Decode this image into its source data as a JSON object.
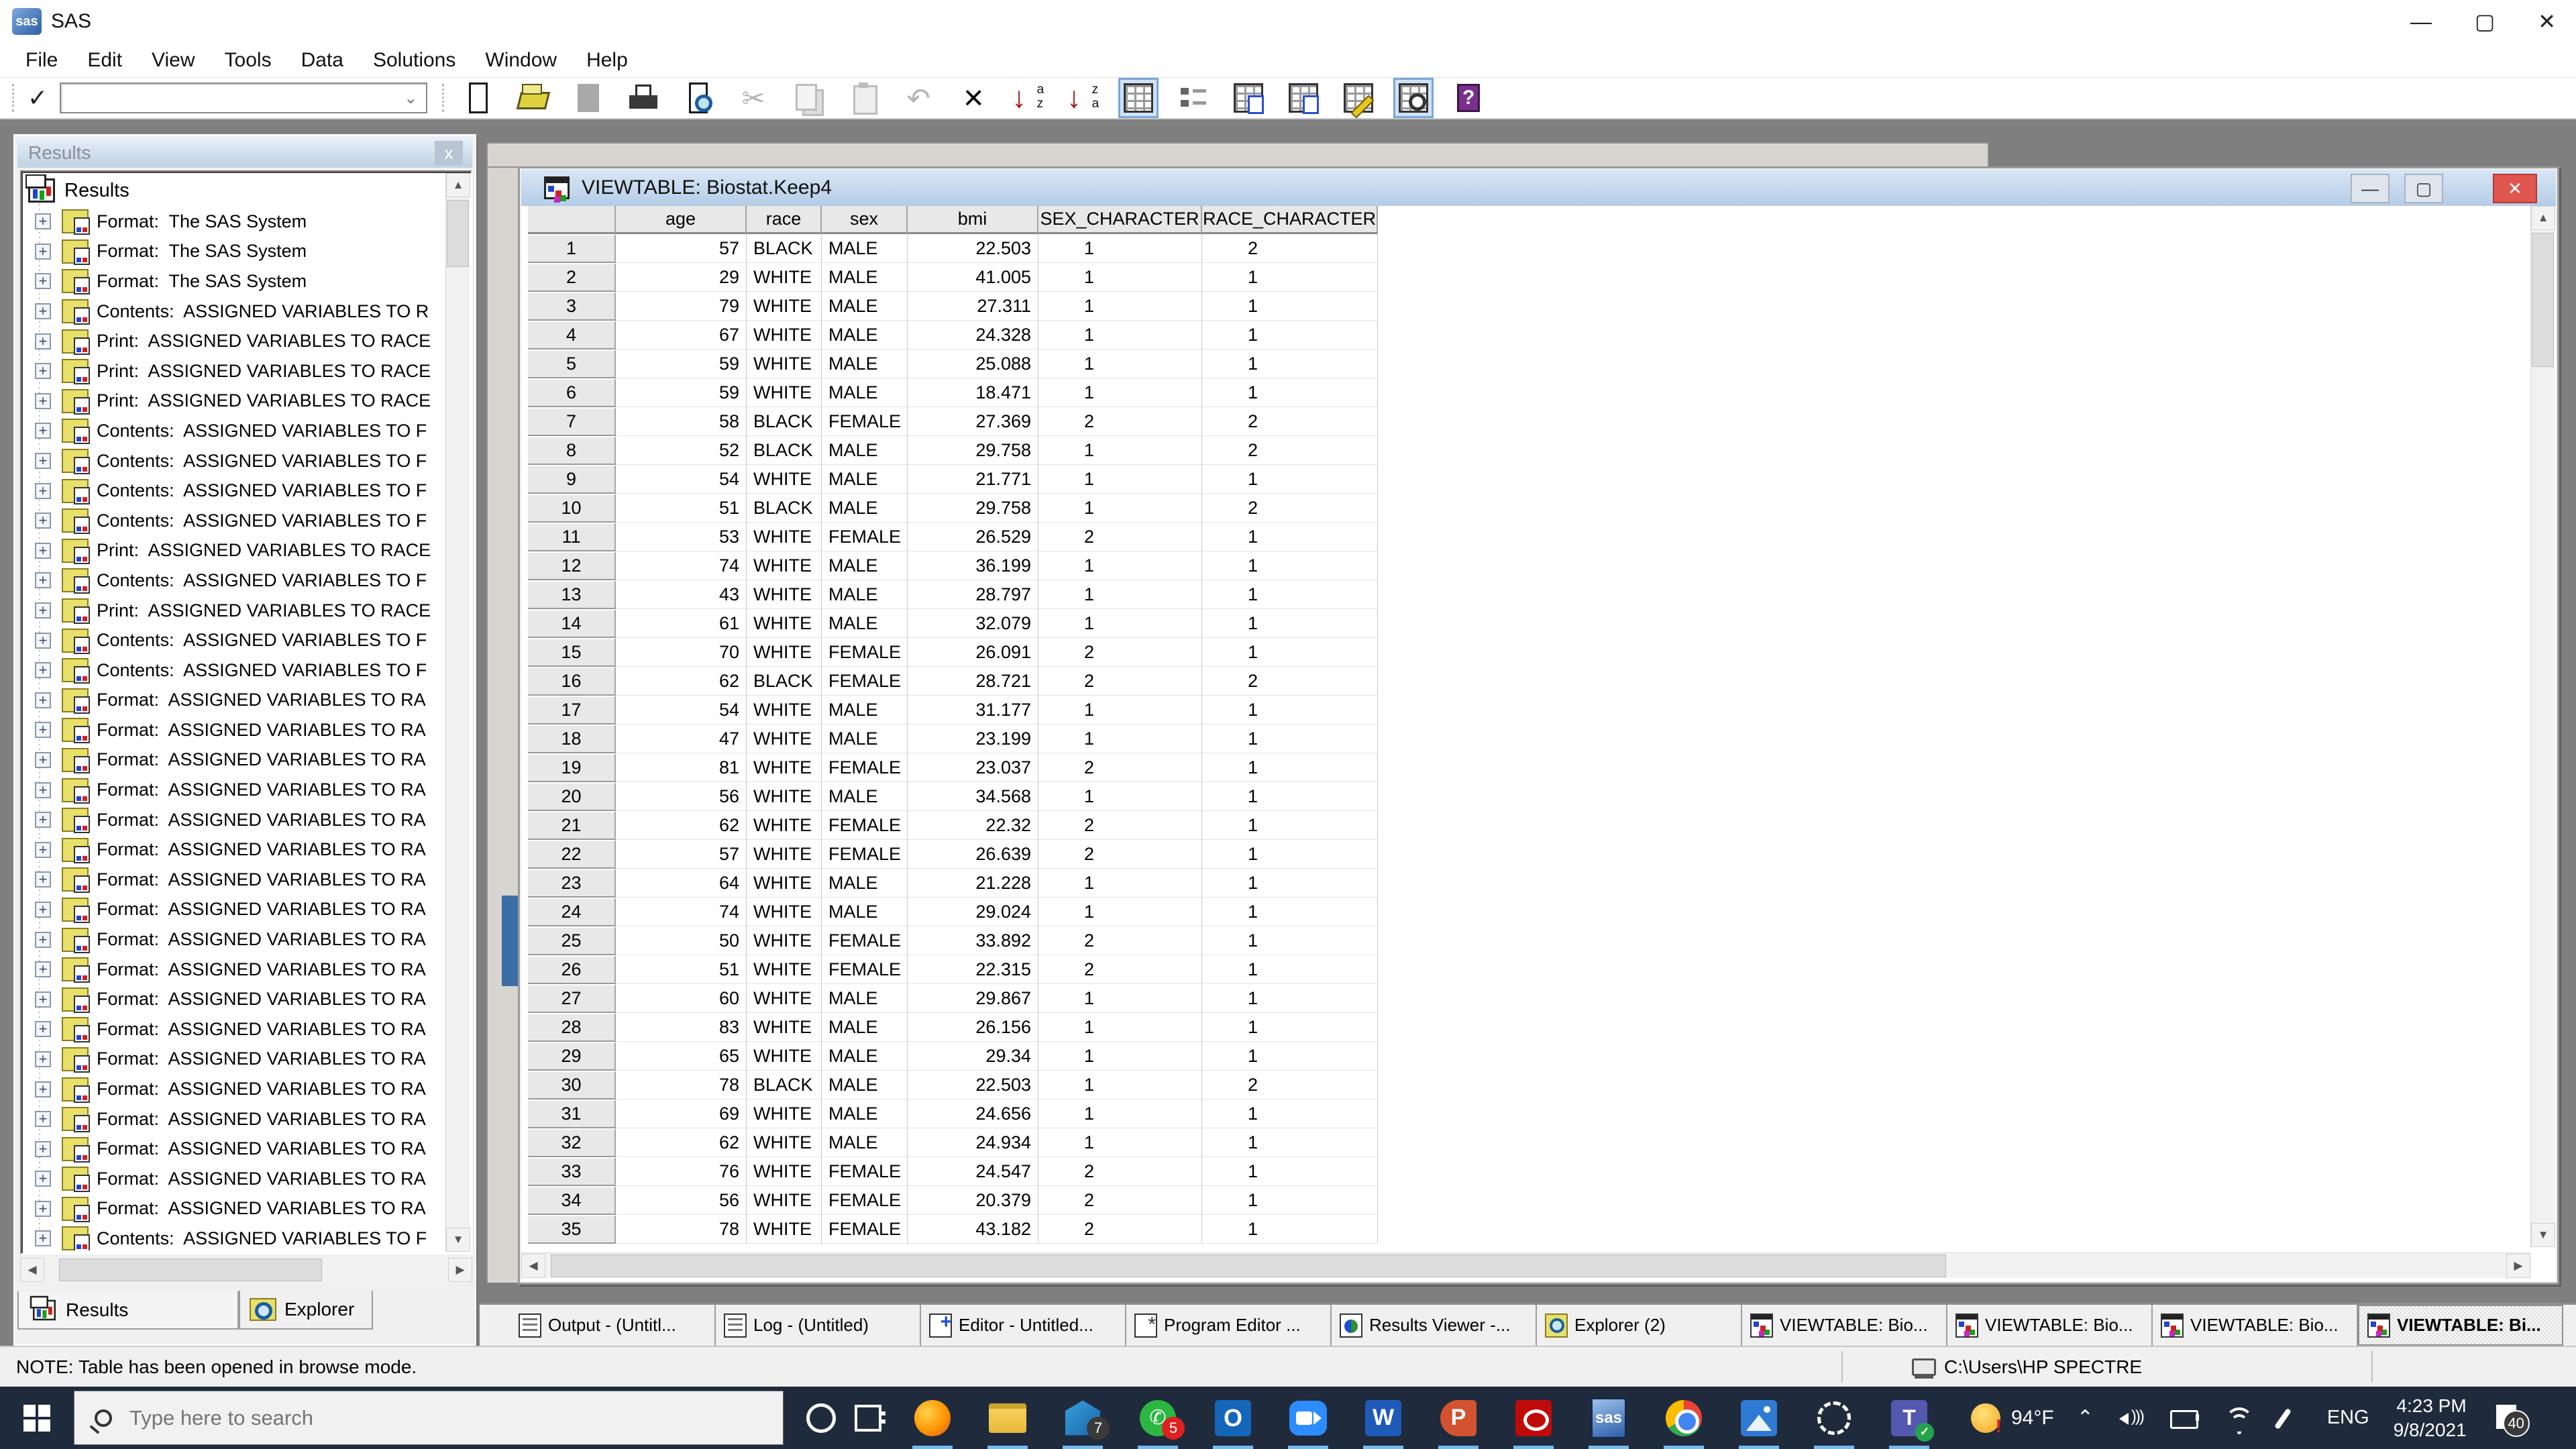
{
  "app": {
    "title": "SAS",
    "menu": [
      {
        "label": "File",
        "name": "menu-file"
      },
      {
        "label": "Edit",
        "name": "menu-edit"
      },
      {
        "label": "View",
        "name": "menu-view"
      },
      {
        "label": "Tools",
        "name": "menu-tools"
      },
      {
        "label": "Data",
        "name": "menu-data"
      },
      {
        "label": "Solutions",
        "name": "menu-solutions"
      },
      {
        "label": "Window",
        "name": "menu-window"
      },
      {
        "label": "Help",
        "name": "menu-help"
      }
    ],
    "window_controls": {
      "minimize": "—",
      "maximize": "▢",
      "close": "✕"
    }
  },
  "toolbar": {
    "command_value": "",
    "icons": [
      {
        "name": "new-document-icon",
        "cls": "tb-new"
      },
      {
        "name": "open-icon",
        "cls": "tb-open"
      },
      {
        "name": "save-icon",
        "cls": "tb-save"
      },
      {
        "name": "print-icon",
        "cls": "tb-print"
      },
      {
        "name": "print-preview-icon",
        "cls": "tb-preview"
      },
      {
        "name": "cut-icon",
        "cls": "tb-cut tb-gray"
      },
      {
        "name": "copy-icon",
        "cls": "tb-copy"
      },
      {
        "name": "paste-icon",
        "cls": "tb-paste"
      },
      {
        "name": "undo-icon",
        "cls": "tb-undo tb-gray"
      },
      {
        "name": "delete-icon",
        "cls": "tb-del"
      },
      {
        "name": "sort-ascending-icon",
        "cls": "tb-sortaz"
      },
      {
        "name": "sort-descending-icon",
        "cls": "tb-sortza"
      },
      {
        "name": "table-view-icon",
        "cls": "tb-grid on"
      },
      {
        "name": "form-view-icon",
        "cls": "tb-details"
      },
      {
        "name": "copy-rows-icon",
        "cls": "tb-grid tb-tdoc"
      },
      {
        "name": "paste-rows-icon",
        "cls": "tb-grid tb-tdoc2"
      },
      {
        "name": "edit-mode-icon",
        "cls": "tb-grid tb-tpencil"
      },
      {
        "name": "where-icon",
        "cls": "tb-grid tb-twhere on"
      },
      {
        "name": "help-book-icon",
        "cls": "tb-book"
      }
    ]
  },
  "results_panel": {
    "title": "Results",
    "root": "Results",
    "items": [
      {
        "label": "Format:  The SAS System"
      },
      {
        "label": "Format:  The SAS System"
      },
      {
        "label": "Format:  The SAS System"
      },
      {
        "label": "Contents:  ASSIGNED VARIABLES TO R"
      },
      {
        "label": "Print:  ASSIGNED VARIABLES TO RACE"
      },
      {
        "label": "Print:  ASSIGNED VARIABLES TO RACE"
      },
      {
        "label": "Print:  ASSIGNED VARIABLES TO RACE"
      },
      {
        "label": "Contents:  ASSIGNED VARIABLES TO F"
      },
      {
        "label": "Contents:  ASSIGNED VARIABLES TO F"
      },
      {
        "label": "Contents:  ASSIGNED VARIABLES TO F"
      },
      {
        "label": "Contents:  ASSIGNED VARIABLES TO F"
      },
      {
        "label": "Print:  ASSIGNED VARIABLES TO RACE"
      },
      {
        "label": "Contents:  ASSIGNED VARIABLES TO F"
      },
      {
        "label": "Print:  ASSIGNED VARIABLES TO RACE"
      },
      {
        "label": "Contents:  ASSIGNED VARIABLES TO F"
      },
      {
        "label": "Contents:  ASSIGNED VARIABLES TO F"
      },
      {
        "label": "Format:  ASSIGNED VARIABLES TO RA"
      },
      {
        "label": "Format:  ASSIGNED VARIABLES TO RA"
      },
      {
        "label": "Format:  ASSIGNED VARIABLES TO RA"
      },
      {
        "label": "Format:  ASSIGNED VARIABLES TO RA"
      },
      {
        "label": "Format:  ASSIGNED VARIABLES TO RA"
      },
      {
        "label": "Format:  ASSIGNED VARIABLES TO RA"
      },
      {
        "label": "Format:  ASSIGNED VARIABLES TO RA"
      },
      {
        "label": "Format:  ASSIGNED VARIABLES TO RA"
      },
      {
        "label": "Format:  ASSIGNED VARIABLES TO RA"
      },
      {
        "label": "Format:  ASSIGNED VARIABLES TO RA"
      },
      {
        "label": "Format:  ASSIGNED VARIABLES TO RA"
      },
      {
        "label": "Format:  ASSIGNED VARIABLES TO RA"
      },
      {
        "label": "Format:  ASSIGNED VARIABLES TO RA"
      },
      {
        "label": "Format:  ASSIGNED VARIABLES TO RA"
      },
      {
        "label": "Format:  ASSIGNED VARIABLES TO RA"
      },
      {
        "label": "Format:  ASSIGNED VARIABLES TO RA"
      },
      {
        "label": "Format:  ASSIGNED VARIABLES TO RA"
      },
      {
        "label": "Format:  ASSIGNED VARIABLES TO RA"
      },
      {
        "label": "Contents:  ASSIGNED VARIABLES TO F"
      }
    ],
    "tabs": {
      "results": "Results",
      "explorer": "Explorer"
    }
  },
  "viewtable": {
    "title": "VIEWTABLE: Biostat.Keep4",
    "columns": [
      {
        "label": "age",
        "cls": "c-age"
      },
      {
        "label": "race",
        "cls": "c-race"
      },
      {
        "label": "sex",
        "cls": "c-sex"
      },
      {
        "label": "bmi",
        "cls": "c-bmi"
      },
      {
        "label": "SEX_CHARACTER",
        "cls": "c-sx"
      },
      {
        "label": "RACE_CHARACTER",
        "cls": "c-rc"
      }
    ],
    "rows": [
      {
        "n": "1",
        "age": "57",
        "race": "BLACK",
        "sex": "MALE",
        "bmi": "22.503",
        "sx": "1",
        "rc": "2"
      },
      {
        "n": "2",
        "age": "29",
        "race": "WHITE",
        "sex": "MALE",
        "bmi": "41.005",
        "sx": "1",
        "rc": "1"
      },
      {
        "n": "3",
        "age": "79",
        "race": "WHITE",
        "sex": "MALE",
        "bmi": "27.311",
        "sx": "1",
        "rc": "1"
      },
      {
        "n": "4",
        "age": "67",
        "race": "WHITE",
        "sex": "MALE",
        "bmi": "24.328",
        "sx": "1",
        "rc": "1"
      },
      {
        "n": "5",
        "age": "59",
        "race": "WHITE",
        "sex": "MALE",
        "bmi": "25.088",
        "sx": "1",
        "rc": "1"
      },
      {
        "n": "6",
        "age": "59",
        "race": "WHITE",
        "sex": "MALE",
        "bmi": "18.471",
        "sx": "1",
        "rc": "1"
      },
      {
        "n": "7",
        "age": "58",
        "race": "BLACK",
        "sex": "FEMALE",
        "bmi": "27.369",
        "sx": "2",
        "rc": "2"
      },
      {
        "n": "8",
        "age": "52",
        "race": "BLACK",
        "sex": "MALE",
        "bmi": "29.758",
        "sx": "1",
        "rc": "2"
      },
      {
        "n": "9",
        "age": "54",
        "race": "WHITE",
        "sex": "MALE",
        "bmi": "21.771",
        "sx": "1",
        "rc": "1"
      },
      {
        "n": "10",
        "age": "51",
        "race": "BLACK",
        "sex": "MALE",
        "bmi": "29.758",
        "sx": "1",
        "rc": "2"
      },
      {
        "n": "11",
        "age": "53",
        "race": "WHITE",
        "sex": "FEMALE",
        "bmi": "26.529",
        "sx": "2",
        "rc": "1"
      },
      {
        "n": "12",
        "age": "74",
        "race": "WHITE",
        "sex": "MALE",
        "bmi": "36.199",
        "sx": "1",
        "rc": "1"
      },
      {
        "n": "13",
        "age": "43",
        "race": "WHITE",
        "sex": "MALE",
        "bmi": "28.797",
        "sx": "1",
        "rc": "1"
      },
      {
        "n": "14",
        "age": "61",
        "race": "WHITE",
        "sex": "MALE",
        "bmi": "32.079",
        "sx": "1",
        "rc": "1"
      },
      {
        "n": "15",
        "age": "70",
        "race": "WHITE",
        "sex": "FEMALE",
        "bmi": "26.091",
        "sx": "2",
        "rc": "1"
      },
      {
        "n": "16",
        "age": "62",
        "race": "BLACK",
        "sex": "FEMALE",
        "bmi": "28.721",
        "sx": "2",
        "rc": "2"
      },
      {
        "n": "17",
        "age": "54",
        "race": "WHITE",
        "sex": "MALE",
        "bmi": "31.177",
        "sx": "1",
        "rc": "1"
      },
      {
        "n": "18",
        "age": "47",
        "race": "WHITE",
        "sex": "MALE",
        "bmi": "23.199",
        "sx": "1",
        "rc": "1"
      },
      {
        "n": "19",
        "age": "81",
        "race": "WHITE",
        "sex": "FEMALE",
        "bmi": "23.037",
        "sx": "2",
        "rc": "1"
      },
      {
        "n": "20",
        "age": "56",
        "race": "WHITE",
        "sex": "MALE",
        "bmi": "34.568",
        "sx": "1",
        "rc": "1"
      },
      {
        "n": "21",
        "age": "62",
        "race": "WHITE",
        "sex": "FEMALE",
        "bmi": "22.32",
        "sx": "2",
        "rc": "1"
      },
      {
        "n": "22",
        "age": "57",
        "race": "WHITE",
        "sex": "FEMALE",
        "bmi": "26.639",
        "sx": "2",
        "rc": "1"
      },
      {
        "n": "23",
        "age": "64",
        "race": "WHITE",
        "sex": "MALE",
        "bmi": "21.228",
        "sx": "1",
        "rc": "1"
      },
      {
        "n": "24",
        "age": "74",
        "race": "WHITE",
        "sex": "MALE",
        "bmi": "29.024",
        "sx": "1",
        "rc": "1"
      },
      {
        "n": "25",
        "age": "50",
        "race": "WHITE",
        "sex": "FEMALE",
        "bmi": "33.892",
        "sx": "2",
        "rc": "1"
      },
      {
        "n": "26",
        "age": "51",
        "race": "WHITE",
        "sex": "FEMALE",
        "bmi": "22.315",
        "sx": "2",
        "rc": "1"
      },
      {
        "n": "27",
        "age": "60",
        "race": "WHITE",
        "sex": "MALE",
        "bmi": "29.867",
        "sx": "1",
        "rc": "1"
      },
      {
        "n": "28",
        "age": "83",
        "race": "WHITE",
        "sex": "MALE",
        "bmi": "26.156",
        "sx": "1",
        "rc": "1"
      },
      {
        "n": "29",
        "age": "65",
        "race": "WHITE",
        "sex": "MALE",
        "bmi": "29.34",
        "sx": "1",
        "rc": "1"
      },
      {
        "n": "30",
        "age": "78",
        "race": "BLACK",
        "sex": "MALE",
        "bmi": "22.503",
        "sx": "1",
        "rc": "2"
      },
      {
        "n": "31",
        "age": "69",
        "race": "WHITE",
        "sex": "MALE",
        "bmi": "24.656",
        "sx": "1",
        "rc": "1"
      },
      {
        "n": "32",
        "age": "62",
        "race": "WHITE",
        "sex": "MALE",
        "bmi": "24.934",
        "sx": "1",
        "rc": "1"
      },
      {
        "n": "33",
        "age": "76",
        "race": "WHITE",
        "sex": "FEMALE",
        "bmi": "24.547",
        "sx": "2",
        "rc": "1"
      },
      {
        "n": "34",
        "age": "56",
        "race": "WHITE",
        "sex": "FEMALE",
        "bmi": "20.379",
        "sx": "2",
        "rc": "1"
      },
      {
        "n": "35",
        "age": "78",
        "race": "WHITE",
        "sex": "FEMALE",
        "bmi": "43.182",
        "sx": "2",
        "rc": "1"
      }
    ]
  },
  "window_bar": {
    "tabs": [
      {
        "label": "Output - (Untitl...",
        "name": "tab-output",
        "icon_cls": "wi-doc",
        "state": ""
      },
      {
        "label": "Log - (Untitled)",
        "name": "tab-log",
        "icon_cls": "wi-doc",
        "state": ""
      },
      {
        "label": "Editor - Untitled...",
        "name": "tab-editor",
        "icon_cls": "wi-editor",
        "state": ""
      },
      {
        "label": "Program Editor ...",
        "name": "tab-program-editor",
        "icon_cls": "wi-prog",
        "state": ""
      },
      {
        "label": "Results Viewer -...",
        "name": "tab-results-viewer",
        "icon_cls": "wi-viewer",
        "state": ""
      },
      {
        "label": "Explorer (2)",
        "name": "tab-explorer",
        "icon_cls": "wi-exp",
        "state": ""
      },
      {
        "label": "VIEWTABLE: Bio...",
        "name": "tab-viewtable-1",
        "icon_cls": "wi-vt",
        "state": ""
      },
      {
        "label": "VIEWTABLE: Bio...",
        "name": "tab-viewtable-2",
        "icon_cls": "wi-vt",
        "state": ""
      },
      {
        "label": "VIEWTABLE: Bio...",
        "name": "tab-viewtable-3",
        "icon_cls": "wi-vt",
        "state": ""
      },
      {
        "label": "VIEWTABLE: Bi...",
        "name": "tab-viewtable-active",
        "icon_cls": "wi-vt",
        "state": "tab-active"
      }
    ]
  },
  "status_bar": {
    "note": "NOTE: Table has been opened in browse mode.",
    "path": "C:\\Users\\HP SPECTRE"
  },
  "taskbar": {
    "search_placeholder": "Type here to search",
    "apps": [
      {
        "name": "firefox-icon",
        "cls": "app-firefox",
        "state": ""
      },
      {
        "name": "file-explorer-icon",
        "cls": "app-explorer",
        "state": ""
      },
      {
        "name": "mail-icon",
        "cls": "app-mail",
        "badge": "7",
        "state": ""
      },
      {
        "name": "whatsapp-icon",
        "cls": "app-whatsapp",
        "badge": "5",
        "state": ""
      },
      {
        "name": "outlook-icon",
        "cls": "app-outlook",
        "glyph": "O",
        "state": ""
      },
      {
        "name": "zoom-icon",
        "cls": "app-zoom",
        "state": ""
      },
      {
        "name": "word-icon",
        "cls": "app-word",
        "glyph": "W",
        "state": ""
      },
      {
        "name": "powerpoint-icon",
        "cls": "app-ppt",
        "glyph": "P",
        "state": ""
      },
      {
        "name": "acrobat-icon",
        "cls": "app-acrobat",
        "state": ""
      },
      {
        "name": "sas-taskbar-icon",
        "cls": "app-sas",
        "glyph": "sas",
        "state": "app-active"
      },
      {
        "name": "chrome-icon",
        "cls": "app-chrome",
        "state": ""
      },
      {
        "name": "photos-icon",
        "cls": "app-photos",
        "state": ""
      },
      {
        "name": "signal-icon",
        "cls": "app-signal",
        "state": ""
      },
      {
        "name": "teams-icon",
        "cls": "app-teams",
        "glyph": "T",
        "state": ""
      }
    ],
    "tray": {
      "temperature": "94°F",
      "chevron": "⌃",
      "language": "ENG",
      "time": "4:23 PM",
      "date": "9/8/2021",
      "notification_count": "40"
    }
  }
}
